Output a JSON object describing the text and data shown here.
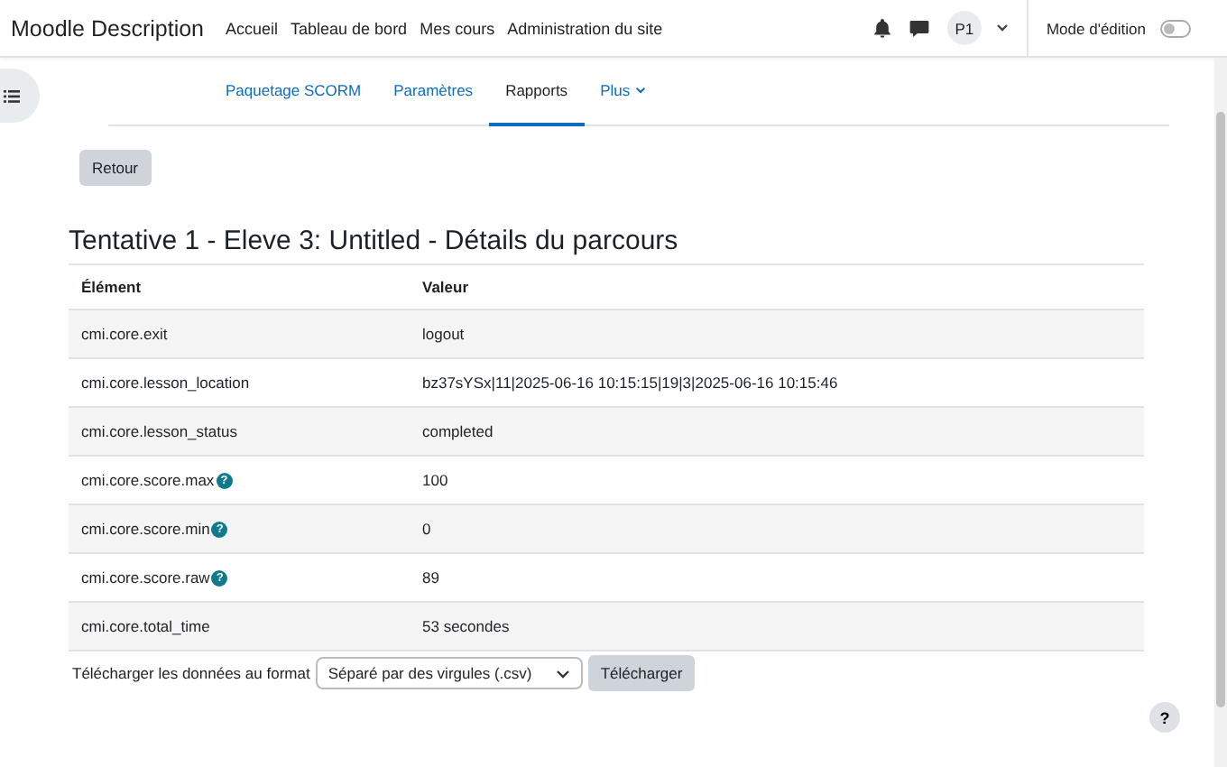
{
  "navbar": {
    "brand": "Moodle Description",
    "links": [
      "Accueil",
      "Tableau de bord",
      "Mes cours",
      "Administration du site"
    ],
    "avatar": "P1",
    "edit_mode": {
      "label": "Mode d'édition",
      "on": false
    }
  },
  "tabs": [
    {
      "label": "Paquetage SCORM",
      "selected": false,
      "menu": false
    },
    {
      "label": "Paramètres",
      "selected": false,
      "menu": false
    },
    {
      "label": "Rapports",
      "selected": true,
      "menu": false
    },
    {
      "label": "Plus",
      "selected": false,
      "menu": true
    }
  ],
  "back_button": "Retour",
  "heading": "Tentative 1 - Eleve 3: Untitled - Détails du parcours",
  "table": {
    "columns": [
      "Élément",
      "Valeur"
    ],
    "rows": [
      {
        "element": "cmi.core.exit",
        "value": "logout"
      },
      {
        "element": "cmi.core.lesson_location",
        "value": "bz37sYSx|11|2025-06-16 10:15:15|19|3|2025-06-16 10:15:46"
      },
      {
        "element": "cmi.core.lesson_status",
        "value": "completed"
      },
      {
        "element": "cmi.core.score.max",
        "help": "?",
        "value": "100"
      },
      {
        "element": "cmi.core.score.min",
        "help": "?",
        "value": "0"
      },
      {
        "element": "cmi.core.score.raw",
        "help": "?",
        "value": "89"
      },
      {
        "element": "cmi.core.total_time",
        "value": "53 secondes"
      }
    ]
  },
  "download": {
    "label": "Télécharger les données au format",
    "format": "Séparé par des virgules (.csv)",
    "button": "Télécharger"
  },
  "help_button": "?"
}
